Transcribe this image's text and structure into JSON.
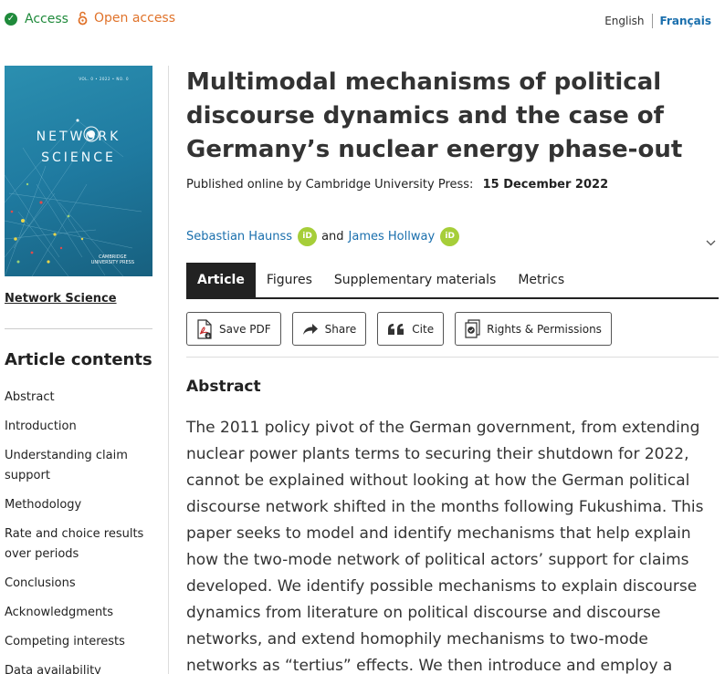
{
  "topbar": {
    "access_label": "Access",
    "open_access_label": "Open access",
    "lang_en": "English",
    "lang_fr": "Français"
  },
  "sidebar": {
    "cover": {
      "issue_line": "VOL. 0 • 2022 • NO. 0",
      "title_line1": "NETWORK",
      "title_line2": "SCIENCE",
      "publisher_line1": "CAMBRIDGE",
      "publisher_line2": "UNIVERSITY PRESS"
    },
    "journal_link": "Network Science",
    "contents_title": "Article contents",
    "contents": [
      "Abstract",
      "Introduction",
      "Understanding claim support",
      "Methodology",
      "Rate and choice results over periods",
      "Conclusions",
      "Acknowledgments",
      "Competing interests",
      "Data availability"
    ]
  },
  "article": {
    "title": "Multimodal mechanisms of political discourse dynamics and the case of Germany’s nuclear energy phase-out",
    "published_prefix": "Published online by Cambridge University Press:",
    "published_date": "15 December 2022",
    "author1": "Sebastian Haunss",
    "author_and": "and",
    "author2": "James Hollway",
    "orcid_label": "iD"
  },
  "tabs": [
    "Article",
    "Figures",
    "Supplementary materials",
    "Metrics"
  ],
  "actions": {
    "save_pdf": "Save PDF",
    "share": "Share",
    "cite": "Cite",
    "rights": "Rights & Permissions"
  },
  "abstract": {
    "heading": "Abstract",
    "text": "The 2011 policy pivot of the German government, from extending nuclear power plants terms to securing their shutdown for 2022, cannot be explained without looking at how the German political discourse network shifted in the months following Fukushima. This paper seeks to model and identify mechanisms that help explain how the two-mode network of political actors’ support for claims developed. We identify possible mechanisms to explain discourse dynamics from literature on political discourse and discourse networks, and extend homophily mechanisms to two-mode networks as “tertius” effects. We then introduce and employ a"
  },
  "colors": {
    "link": "#1a6fad",
    "access_green": "#1f8a3b",
    "open_access_orange": "#e0732b",
    "orcid_green": "#a6ce39",
    "cover_teal": "#1f7aa0"
  }
}
